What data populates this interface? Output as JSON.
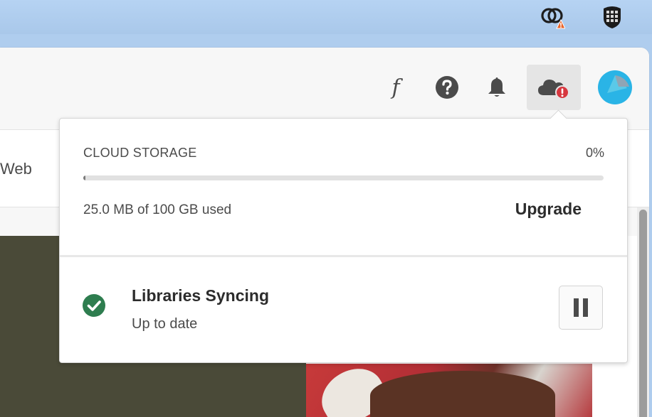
{
  "menubar": {
    "icons": [
      "creative-cloud-warning-icon",
      "shield-grid-icon"
    ]
  },
  "header": {
    "icons": [
      "font-icon",
      "help-icon",
      "bell-icon",
      "cloud-alert-icon",
      "avatar"
    ],
    "font_glyph": "f"
  },
  "subnav": {
    "partial_label": "Web"
  },
  "popover": {
    "storage": {
      "title": "CLOUD STORAGE",
      "percent": "0%",
      "used_fraction": 0.002,
      "used_text": "25.0 MB of 100 GB used",
      "upgrade_label": "Upgrade"
    },
    "sync": {
      "title": "Libraries Syncing",
      "status": "Up to date",
      "pause_icon": "pause-icon"
    }
  },
  "colors": {
    "accent_green": "#2e7d4f",
    "alert_red": "#d7373f",
    "warning_orange": "#e8662c",
    "avatar_blue": "#2ab4e6"
  }
}
